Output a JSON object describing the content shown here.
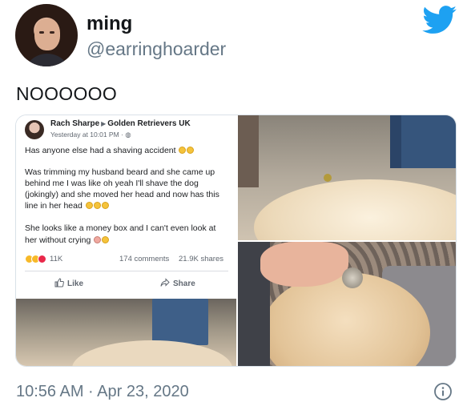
{
  "user": {
    "display_name": "ming",
    "handle": "@earringhoarder"
  },
  "tweet": {
    "text": "NOOOOOO",
    "timestamp": "10:56 AM · Apr 23, 2020"
  },
  "embedded_post": {
    "author": "Rach Sharpe",
    "group": "Golden Retrievers UK",
    "time": "Yesterday at 10:01 PM ·",
    "lines": [
      "Has anyone else had a shaving accident",
      "Was trimming my husband beard and she came up",
      "behind me I was like oh yeah I'll shave the dog",
      "(jokingly) and she moved her head and now has this",
      "line in her head",
      "She looks like a money box and I can't even look at",
      "her without crying"
    ],
    "reactions_count": "11K",
    "comments": "174 comments",
    "shares": "21.9K shares",
    "like_label": "Like",
    "share_label": "Share"
  },
  "colors": {
    "twitter_blue": "#1da1f2",
    "secondary_text": "#657786",
    "facebook_gray": "#606770"
  },
  "icons": {
    "logo": "twitter-bird-icon",
    "info": "info-circle-icon",
    "like": "thumbs-up-icon",
    "share": "share-arrow-icon"
  }
}
